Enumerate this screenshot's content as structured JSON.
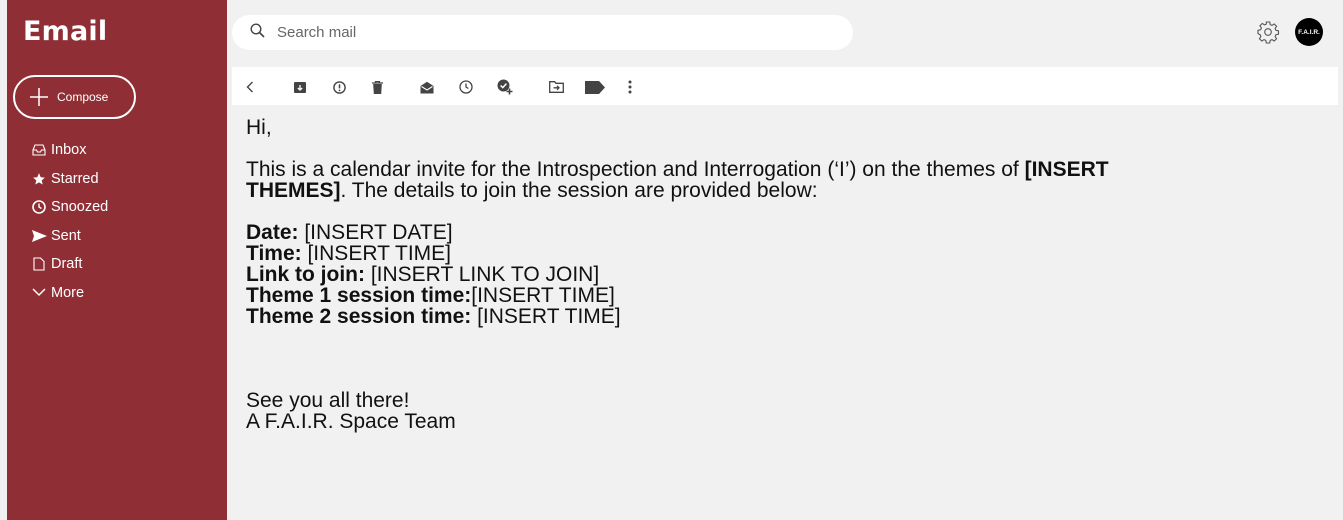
{
  "sidebar": {
    "brand": "Email",
    "compose_label": "Compose",
    "items": [
      {
        "label": "Inbox",
        "icon": "inbox-icon"
      },
      {
        "label": "Starred",
        "icon": "star-icon"
      },
      {
        "label": "Snoozed",
        "icon": "clock-icon"
      },
      {
        "label": "Sent",
        "icon": "send-icon"
      },
      {
        "label": "Draft",
        "icon": "draft-icon"
      },
      {
        "label": "More",
        "icon": "chevron-down-icon"
      }
    ]
  },
  "search": {
    "placeholder": "Search mail"
  },
  "header": {
    "avatar_text": "F.A.I.R."
  },
  "toolbar": {
    "icons": [
      "back-icon",
      "archive-icon",
      "report-spam-icon",
      "delete-icon",
      "mark-unread-icon",
      "snooze-icon",
      "add-task-icon",
      "move-to-icon",
      "label-icon",
      "more-icon"
    ]
  },
  "email": {
    "greeting": "Hi,",
    "intro_prefix": "This is a calendar invite for the Introspection and Interrogation (‘I’) on the themes of ",
    "intro_themes": "[INSERT",
    "intro_themes_2": "THEMES]",
    "intro_suffix": ". The details to join the session are provided below:",
    "details": [
      {
        "label": "Date:",
        "value": " [INSERT DATE]"
      },
      {
        "label": "Time:",
        "value": " [INSERT TIME]"
      },
      {
        "label": "Link to join:",
        "value": " [INSERT LINK TO JOIN]"
      },
      {
        "label": "Theme 1 session time:",
        "value": "[INSERT TIME]"
      },
      {
        "label": "Theme 2 session time:",
        "value": " [INSERT TIME]"
      }
    ],
    "closing": "See you all there!",
    "signature": "A F.A.I.R. Space Team"
  },
  "colors": {
    "sidebar": "#8f2f35",
    "background": "#f1f1f1"
  }
}
